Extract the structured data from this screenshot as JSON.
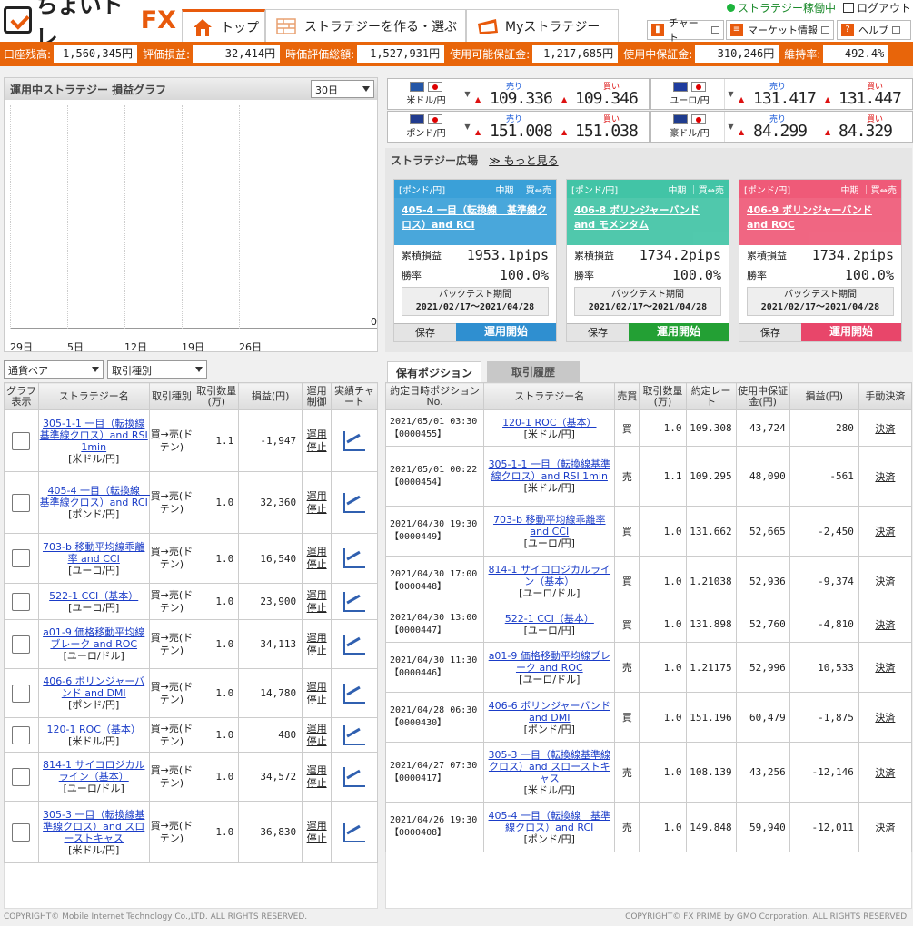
{
  "header": {
    "logo_text": "ちょいトレ",
    "logo_fx": "FX",
    "tabs": [
      {
        "label": "トップ"
      },
      {
        "label": "ストラテジーを作る・選ぶ"
      },
      {
        "label": "Myストラテジー"
      }
    ],
    "status": "ストラテジー稼働中",
    "logout": "ログアウト",
    "buttons": [
      {
        "label": "チャート"
      },
      {
        "label": "マーケット情報"
      },
      {
        "label": "ヘルプ"
      }
    ],
    "help_mark": "?"
  },
  "account": {
    "items": [
      {
        "label": "口座残高:",
        "value": "1,560,345円"
      },
      {
        "label": "評価損益:",
        "value": "-32,414円"
      },
      {
        "label": "時価評価総額:",
        "value": "1,527,931円"
      },
      {
        "label": "使用可能保証金:",
        "value": "1,217,685円"
      },
      {
        "label": "使用中保証金:",
        "value": "310,246円"
      },
      {
        "label": "維持率:",
        "value": "492.4%"
      }
    ]
  },
  "graph": {
    "title": "運用中ストラテジー 損益グラフ",
    "period": "30日",
    "zero": "0",
    "x_labels": [
      "29日",
      "5日",
      "12日",
      "19日",
      "26日"
    ]
  },
  "filters": {
    "pair": "通貨ペア",
    "kind": "取引種別"
  },
  "left_table": {
    "headers": [
      "グラフ表示",
      "ストラテジー名",
      "取引種別",
      "取引数量(万)",
      "損益(円)",
      "運用制御",
      "実績チャート"
    ],
    "rows": [
      {
        "name": "305-1-1 一目（転換線基準線クロス）and RSI 1min",
        "pair": "[米ドル/円]",
        "kind": "買→売(ドテン)",
        "qty": "1.1",
        "pl": "-1,947",
        "ctl": "運用停止"
      },
      {
        "name": "405-4 一目（転換線　基準線クロス）and RCI",
        "pair": "[ポンド/円]",
        "kind": "買→売(ドテン)",
        "qty": "1.0",
        "pl": "32,360",
        "ctl": "運用停止"
      },
      {
        "name": "703-b 移動平均線乖離率 and CCI",
        "pair": "[ユーロ/円]",
        "kind": "買→売(ドテン)",
        "qty": "1.0",
        "pl": "16,540",
        "ctl": "運用停止"
      },
      {
        "name": "522-1 CCI（基本）",
        "pair": "[ユーロ/円]",
        "kind": "買→売(ドテン)",
        "qty": "1.0",
        "pl": "23,900",
        "ctl": "運用停止"
      },
      {
        "name": "a01-9 価格移動平均線ブレーク and ROC",
        "pair": "[ユーロ/ドル]",
        "kind": "買→売(ドテン)",
        "qty": "1.0",
        "pl": "34,113",
        "ctl": "運用停止"
      },
      {
        "name": "406-6 ボリンジャーバンド and DMI",
        "pair": "[ポンド/円]",
        "kind": "買→売(ドテン)",
        "qty": "1.0",
        "pl": "14,780",
        "ctl": "運用停止"
      },
      {
        "name": "120-1 ROC（基本）",
        "pair": "[米ドル/円]",
        "kind": "買→売(ドテン)",
        "qty": "1.0",
        "pl": "480",
        "ctl": "運用停止"
      },
      {
        "name": "814-1 サイコロジカルライン（基本）",
        "pair": "[ユーロ/ドル]",
        "kind": "買→売(ドテン)",
        "qty": "1.0",
        "pl": "34,572",
        "ctl": "運用停止"
      },
      {
        "name": "305-3 一目（転換線基準線クロス）and スローストキャス",
        "pair": "[米ドル/円]",
        "kind": "買→売(ドテン)",
        "qty": "1.0",
        "pl": "36,830",
        "ctl": "運用停止"
      }
    ]
  },
  "rates": [
    {
      "pair": "米ドル/円",
      "sell_label": "売り",
      "buy_label": "買い",
      "sell": "109.336",
      "buy": "109.346"
    },
    {
      "pair": "ユーロ/円",
      "sell_label": "売り",
      "buy_label": "買い",
      "sell": "131.417",
      "buy": "131.447"
    },
    {
      "pair": "ポンド/円",
      "sell_label": "売り",
      "buy_label": "買い",
      "sell": "151.008",
      "buy": "151.038"
    },
    {
      "pair": "豪ドル/円",
      "sell_label": "売り",
      "buy_label": "買い",
      "sell": "84.299",
      "buy": "84.329"
    }
  ],
  "plaza": {
    "title": "ストラテジー広場",
    "more": "≫ もっと見る",
    "cards": [
      {
        "tag": "[ポンド/円]",
        "term": "中期 ｜買⇔売",
        "name": "405-4 一目（転換線　基準線クロス）and RCI",
        "pl_label": "累積損益",
        "pl": "1953.1pips",
        "win_label": "勝率",
        "win": "100.0%",
        "bt_label": "バックテスト期間",
        "bt": "2021/02/17～2021/04/28",
        "save": "保存",
        "start": "運用開始",
        "color": "#3aa0d8",
        "btn_color": "#2f8fd0"
      },
      {
        "tag": "[ポンド/円]",
        "term": "中期 ｜買⇔売",
        "name": "406-8 ボリンジャーバンド and モメンタム",
        "pl_label": "累積損益",
        "pl": "1734.2pips",
        "win_label": "勝率",
        "win": "100.0%",
        "bt_label": "バックテスト期間",
        "bt": "2021/02/17～2021/04/28",
        "save": "保存",
        "start": "運用開始",
        "color": "#42c4a6",
        "btn_color": "#23a034"
      },
      {
        "tag": "[ポンド/円]",
        "term": "中期 ｜買⇔売",
        "name": "406-9 ボリンジャーバンド and ROC",
        "pl_label": "累積損益",
        "pl": "1734.2pips",
        "win_label": "勝率",
        "win": "100.0%",
        "bt_label": "バックテスト期間",
        "bt": "2021/02/17～2021/04/28",
        "save": "保存",
        "start": "運用開始",
        "color": "#ef5a78",
        "btn_color": "#e8466a"
      }
    ]
  },
  "right_tabs": {
    "positions": "保有ポジション",
    "history": "取引履歴"
  },
  "right_table": {
    "headers": [
      "約定日時ポジションNo.",
      "ストラテジー名",
      "売買",
      "取引数量(万)",
      "約定レート",
      "使用中保証金(円)",
      "損益(円)",
      "手動決済"
    ],
    "rows": [
      {
        "date": "2021/05/01 03:30",
        "no": "【0000455】",
        "name": "120-1 ROC（基本）",
        "pair": "[米ドル/円]",
        "side": "買",
        "qty": "1.0",
        "rate": "109.308",
        "margin": "43,724",
        "pl": "280",
        "act": "決済"
      },
      {
        "date": "2021/05/01 00:22",
        "no": "【0000454】",
        "name": "305-1-1 一目（転換線基準線クロス）and RSI 1min",
        "pair": "[米ドル/円]",
        "side": "売",
        "qty": "1.1",
        "rate": "109.295",
        "margin": "48,090",
        "pl": "-561",
        "act": "決済"
      },
      {
        "date": "2021/04/30 19:30",
        "no": "【0000449】",
        "name": "703-b 移動平均線乖離率 and CCI",
        "pair": "[ユーロ/円]",
        "side": "買",
        "qty": "1.0",
        "rate": "131.662",
        "margin": "52,665",
        "pl": "-2,450",
        "act": "決済"
      },
      {
        "date": "2021/04/30 17:00",
        "no": "【0000448】",
        "name": "814-1 サイコロジカルライン（基本）",
        "pair": "[ユーロ/ドル]",
        "side": "買",
        "qty": "1.0",
        "rate": "1.21038",
        "margin": "52,936",
        "pl": "-9,374",
        "act": "決済"
      },
      {
        "date": "2021/04/30 13:00",
        "no": "【0000447】",
        "name": "522-1 CCI（基本）",
        "pair": "[ユーロ/円]",
        "side": "買",
        "qty": "1.0",
        "rate": "131.898",
        "margin": "52,760",
        "pl": "-4,810",
        "act": "決済"
      },
      {
        "date": "2021/04/30 11:30",
        "no": "【0000446】",
        "name": "a01-9 価格移動平均線ブレーク and ROC",
        "pair": "[ユーロ/ドル]",
        "side": "売",
        "qty": "1.0",
        "rate": "1.21175",
        "margin": "52,996",
        "pl": "10,533",
        "act": "決済"
      },
      {
        "date": "2021/04/28 06:30",
        "no": "【0000430】",
        "name": "406-6 ボリンジャーバンド and DMI",
        "pair": "[ポンド/円]",
        "side": "買",
        "qty": "1.0",
        "rate": "151.196",
        "margin": "60,479",
        "pl": "-1,875",
        "act": "決済"
      },
      {
        "date": "2021/04/27 07:30",
        "no": "【0000417】",
        "name": "305-3 一目（転換線基準線クロス）and スローストキャス",
        "pair": "[米ドル/円]",
        "side": "売",
        "qty": "1.0",
        "rate": "108.139",
        "margin": "43,256",
        "pl": "-12,146",
        "act": "決済"
      },
      {
        "date": "2021/04/26 19:30",
        "no": "【0000408】",
        "name": "405-4 一目（転換線　基準線クロス）and RCI",
        "pair": "[ポンド/円]",
        "side": "売",
        "qty": "1.0",
        "rate": "149.848",
        "margin": "59,940",
        "pl": "-12,011",
        "act": "決済"
      }
    ]
  },
  "footer": {
    "left": "COPYRIGHT© Mobile Internet Technology Co.,LTD. ALL RIGHTS RESERVED.",
    "right": "COPYRIGHT© FX PRIME by GMO Corporation. ALL RIGHTS RESERVED."
  },
  "colors": {
    "accent": "#e8650a",
    "link": "#1a3cc8",
    "status_green": "#1db43c"
  }
}
